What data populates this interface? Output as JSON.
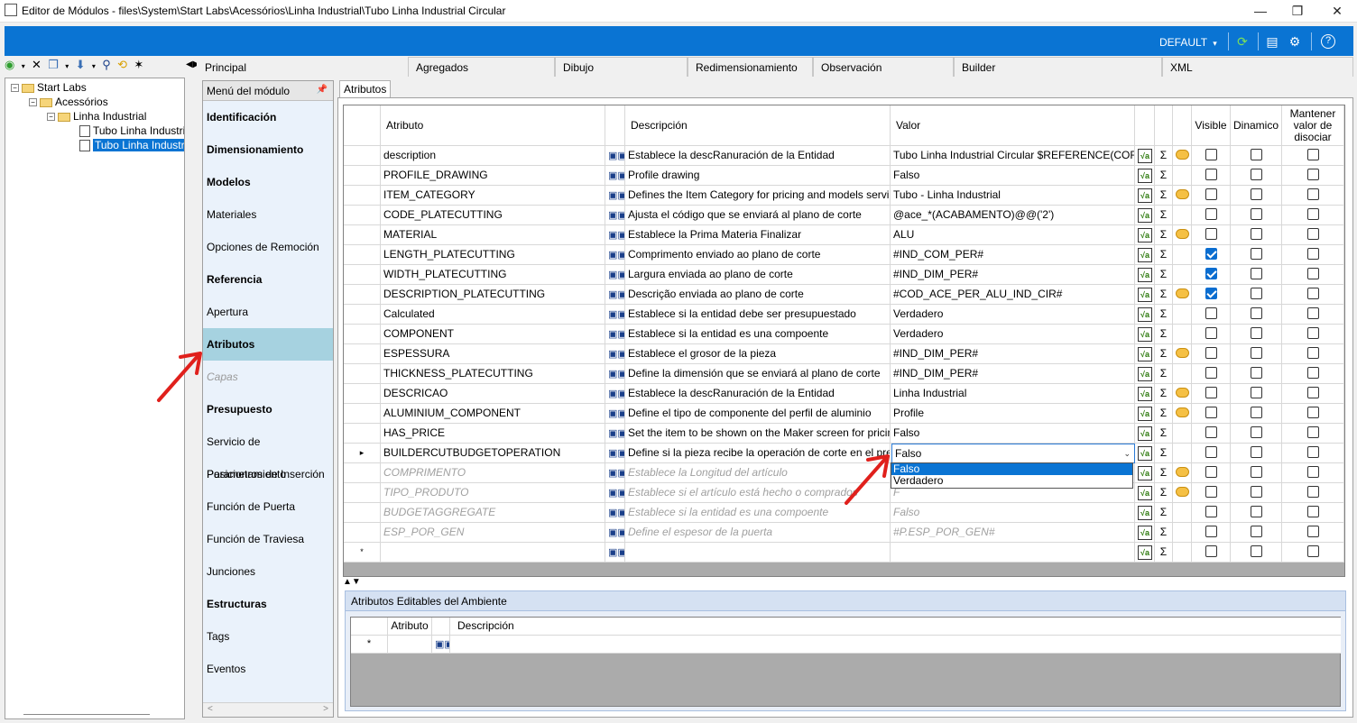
{
  "window": {
    "title": "Editor de Módulos - files\\System\\Start Labs\\Acessórios\\Linha Industrial\\Tubo Linha Industrial Circular",
    "minimize": "—",
    "restore": "❐",
    "close": "✕"
  },
  "ribbon": {
    "profile": "DEFAULT",
    "profile_caret": "▾",
    "icons": [
      "refresh-icon",
      "layout-icon",
      "settings-icon",
      "help-icon"
    ]
  },
  "tree": {
    "nodes": [
      {
        "label": "Start Labs"
      },
      {
        "label": "Acessórios"
      },
      {
        "label": "Linha Industrial"
      },
      {
        "label": "Tubo Linha Industria"
      },
      {
        "label": "Tubo Linha Industria"
      }
    ]
  },
  "tabs": [
    "Principal",
    "Agregados",
    "Dibujo",
    "Redimensionamiento",
    "Observación",
    "Builder",
    "XML"
  ],
  "module_menu": {
    "title": "Menú del módulo",
    "items": [
      {
        "label": "Identificación"
      },
      {
        "label": "Dimensionamiento"
      },
      {
        "label": "Modelos"
      },
      {
        "label": "Materiales"
      },
      {
        "label": "Opciones de Remoción"
      },
      {
        "label": "Referencia"
      },
      {
        "label": "Apertura"
      },
      {
        "label": "Atributos"
      },
      {
        "label": "Capas"
      },
      {
        "label": "Presupuesto"
      },
      {
        "label": "Servicio de Posicionamiento"
      },
      {
        "label": "Parametros de Inserción"
      },
      {
        "label": "Función de Puerta"
      },
      {
        "label": "Función de Traviesa"
      },
      {
        "label": "Junciones"
      },
      {
        "label": "Estructuras"
      },
      {
        "label": "Tags"
      },
      {
        "label": "Eventos"
      }
    ]
  },
  "subtab": "Atributos",
  "grid": {
    "headers": {
      "atributo": "Atributo",
      "descripcion": "Descripción",
      "valor": "Valor",
      "visible": "Visible",
      "dinamico": "Dinamico",
      "mantener": "Mantener valor de disociar"
    },
    "rows": [
      {
        "attr": "description",
        "desc": "Establece la descRanuración de la Entidad",
        "value": "Tubo Linha Industrial Circular $REFERENCE(COR)$",
        "bubble": true,
        "visible": false
      },
      {
        "attr": "PROFILE_DRAWING",
        "desc": "Profile drawing",
        "value": "Falso",
        "bubble": false,
        "visible": false
      },
      {
        "attr": "ITEM_CATEGORY",
        "desc": "Defines the Item Category for pricing and models services on",
        "value": "Tubo - Linha Industrial",
        "bubble": true,
        "visible": false
      },
      {
        "attr": "CODE_PLATECUTTING",
        "desc": "Ajusta el código que se enviará al plano de corte",
        "value": "@ace_*(ACABAMENTO)@@('2')",
        "bubble": false,
        "visible": false
      },
      {
        "attr": "MATERIAL",
        "desc": "Establece la Prima Materia Finalizar",
        "value": "ALU",
        "bubble": true,
        "visible": false
      },
      {
        "attr": "LENGTH_PLATECUTTING",
        "desc": "Comprimento enviado ao plano de corte",
        "value": "#IND_COM_PER#",
        "bubble": false,
        "visible": true
      },
      {
        "attr": "WIDTH_PLATECUTTING",
        "desc": "Largura enviada ao plano de corte",
        "value": "#IND_DIM_PER#",
        "bubble": false,
        "visible": true
      },
      {
        "attr": "DESCRIPTION_PLATECUTTING",
        "desc": "Descrição enviada ao plano de corte",
        "value": "#COD_ACE_PER_ALU_IND_CIR#",
        "bubble": true,
        "visible": true
      },
      {
        "attr": "Calculated",
        "desc": "Establece si la entidad debe ser presupuestado",
        "value": "Verdadero",
        "bubble": false,
        "visible": false
      },
      {
        "attr": "COMPONENT",
        "desc": "Establece si la entidad es una compoente",
        "value": "Verdadero",
        "bubble": false,
        "visible": false
      },
      {
        "attr": "ESPESSURA",
        "desc": "Establece el grosor de la pieza",
        "value": "#IND_DIM_PER#",
        "bubble": true,
        "visible": false
      },
      {
        "attr": "THICKNESS_PLATECUTTING",
        "desc": "Define la dimensión que se enviará al plano de corte",
        "value": "#IND_DIM_PER#",
        "bubble": false,
        "visible": false
      },
      {
        "attr": "DESCRICAO",
        "desc": "Establece la descRanuración de la Entidad",
        "value": "Linha Industrial",
        "bubble": true,
        "visible": false
      },
      {
        "attr": "ALUMINIUM_COMPONENT",
        "desc": "Define el tipo de componente del perfil de aluminio",
        "value": "Profile",
        "bubble": true,
        "visible": false
      },
      {
        "attr": "HAS_PRICE",
        "desc": "Set the item to be shown on the Maker screen for pricing mar",
        "value": "Falso",
        "bubble": false,
        "visible": false
      },
      {
        "attr": "BUILDERCUTBUDGETOPERATION",
        "desc": "Define si la pieza recibe la operación de corte en el presupue",
        "value": "Falso",
        "bubble": false,
        "visible": false,
        "current": true
      },
      {
        "attr": "COMPRIMENTO",
        "desc": "Establece la Longitud del artículo",
        "value": "",
        "bubble": true,
        "visible": false,
        "greyed": true
      },
      {
        "attr": "TIPO_PRODUTO",
        "desc": "Establece si el artículo está hecho o comprados",
        "value": "F",
        "bubble": true,
        "visible": false,
        "greyed": true
      },
      {
        "attr": "BUDGETAGGREGATE",
        "desc": "Establece si la entidad es una compoente",
        "value": "Falso",
        "bubble": false,
        "visible": false,
        "greyed": true
      },
      {
        "attr": "ESP_POR_GEN",
        "desc": "Define el espesor de la puerta",
        "value": "#P.ESP_POR_GEN#",
        "bubble": false,
        "visible": false,
        "greyed": true
      }
    ],
    "new_row_marker": "*",
    "current_row_marker": "▸",
    "sigma": "Σ",
    "fx": "√a"
  },
  "dropdown": {
    "options": [
      "Falso",
      "Verdadero"
    ],
    "selected": "Falso"
  },
  "splitter": "▲▼",
  "env_panel": {
    "title": "Atributos Editables del Ambiente",
    "headers": {
      "atributo": "Atributo",
      "descripcion": "Descripción"
    },
    "new_row_marker": "*"
  }
}
